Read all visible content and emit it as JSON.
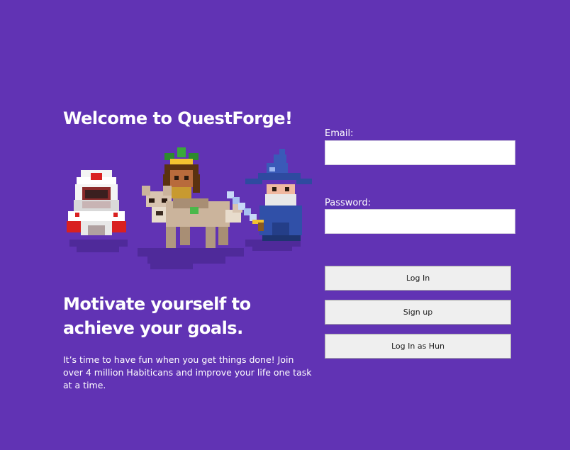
{
  "hero": {
    "welcome_title": "Welcome to QuestForge!",
    "headline": "Motivate yourself to achieve your goals.",
    "blurb": "It’s time to have fun when you get things done! Join over 4 million Habiticans and improve your life one task at a time."
  },
  "login_form": {
    "email_label": "Email:",
    "email_value": "",
    "password_label": "Password:",
    "password_value": "",
    "login_button": "Log In",
    "signup_button": "Sign up",
    "login_as_button": "Log In as Hun"
  },
  "colors": {
    "background": "#6133b4",
    "text": "#ffffff",
    "button_bg": "#efefef",
    "button_border": "#a9a9a9"
  }
}
